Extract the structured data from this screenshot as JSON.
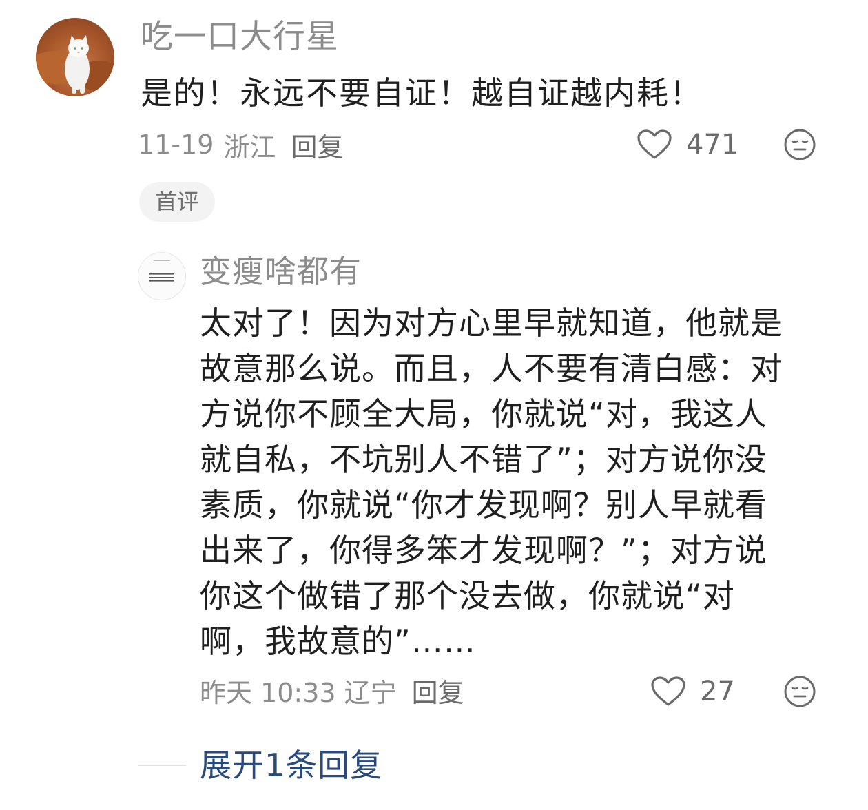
{
  "comment": {
    "username": "吃一口大行星",
    "content": "是的！永远不要自证！越自证越内耗！",
    "date": "11-19",
    "location": "浙江",
    "reply_label": "回复",
    "like_count": "471",
    "badge": "首评",
    "avatar_icon": "white-cat-avatar",
    "like_icon": "heart-outline-icon",
    "emoji_icon": "neutral-face-icon"
  },
  "reply": {
    "username": "变瘦啥都有",
    "avatar_icon": "text-image-avatar",
    "content_lines": [
      "太对了！因为对方心里早就知道，他就是",
      "故意那么说。而且，人不要有清白感：对",
      "方说你不顾全大局，你就说“对，我这人",
      "就自私，不坑别人不错了”；对方说你没",
      "素质，你就说“你才发现啊？别人早就看",
      "出来了，你得多笨才发现啊？”；对方说",
      "你这个做错了那个没去做，你就说“对",
      "啊，我故意的”……"
    ],
    "time": "昨天 10:33",
    "location": "辽宁",
    "reply_label": "回复",
    "like_count": "27"
  },
  "expand_replies_label": "展开1条回复",
  "colors": {
    "meta_text": "#8c8c8c",
    "body_text": "#1f1f1f",
    "link_blue": "#2a4a7c",
    "badge_bg": "#f3f3f3"
  }
}
